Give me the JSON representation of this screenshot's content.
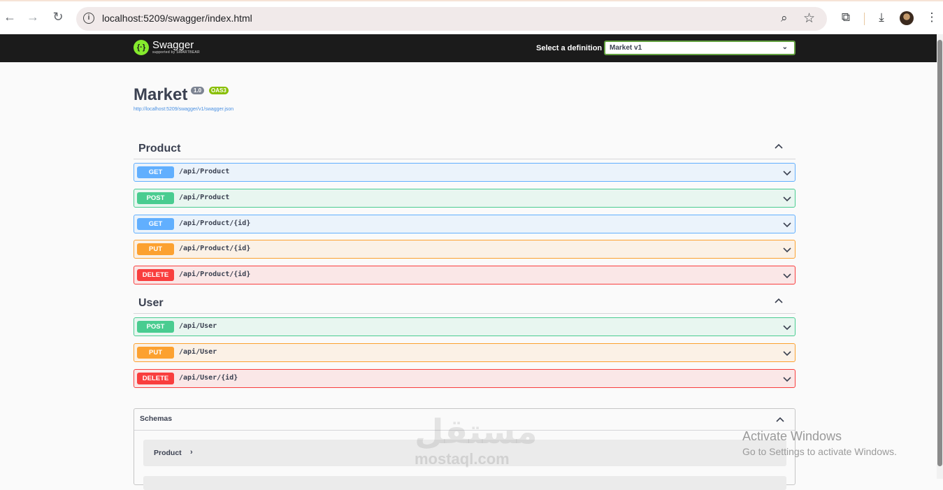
{
  "browser": {
    "url": "localhost:5209/swagger/index.html"
  },
  "topbar": {
    "logo_name": "Swagger",
    "logo_sub": "supported by SMARTBEAR",
    "definition_label": "Select a definition",
    "definition_value": "Market v1"
  },
  "info": {
    "title": "Market",
    "version": "1.0",
    "oas_badge": "OAS3",
    "spec_url": "http://localhost:5209/swagger/v1/swagger.json"
  },
  "tags": [
    {
      "name": "Product",
      "operations": [
        {
          "method": "GET",
          "path": "/api/Product"
        },
        {
          "method": "POST",
          "path": "/api/Product"
        },
        {
          "method": "GET",
          "path": "/api/Product/{id}"
        },
        {
          "method": "PUT",
          "path": "/api/Product/{id}"
        },
        {
          "method": "DELETE",
          "path": "/api/Product/{id}"
        }
      ]
    },
    {
      "name": "User",
      "operations": [
        {
          "method": "POST",
          "path": "/api/User"
        },
        {
          "method": "PUT",
          "path": "/api/User"
        },
        {
          "method": "DELETE",
          "path": "/api/User/{id}"
        }
      ]
    }
  ],
  "schemas": {
    "title": "Schemas",
    "models": [
      "Product"
    ]
  },
  "watermark": {
    "arabic": "مستقل",
    "latin": "mostaql.com"
  },
  "windows_notice": {
    "line1": "Activate Windows",
    "line2": "Go to Settings to activate Windows."
  },
  "colors": {
    "get": "#61affe",
    "post": "#49cc90",
    "put": "#fca130",
    "delete": "#f93e3e",
    "swagger_green": "#85ea2d"
  }
}
